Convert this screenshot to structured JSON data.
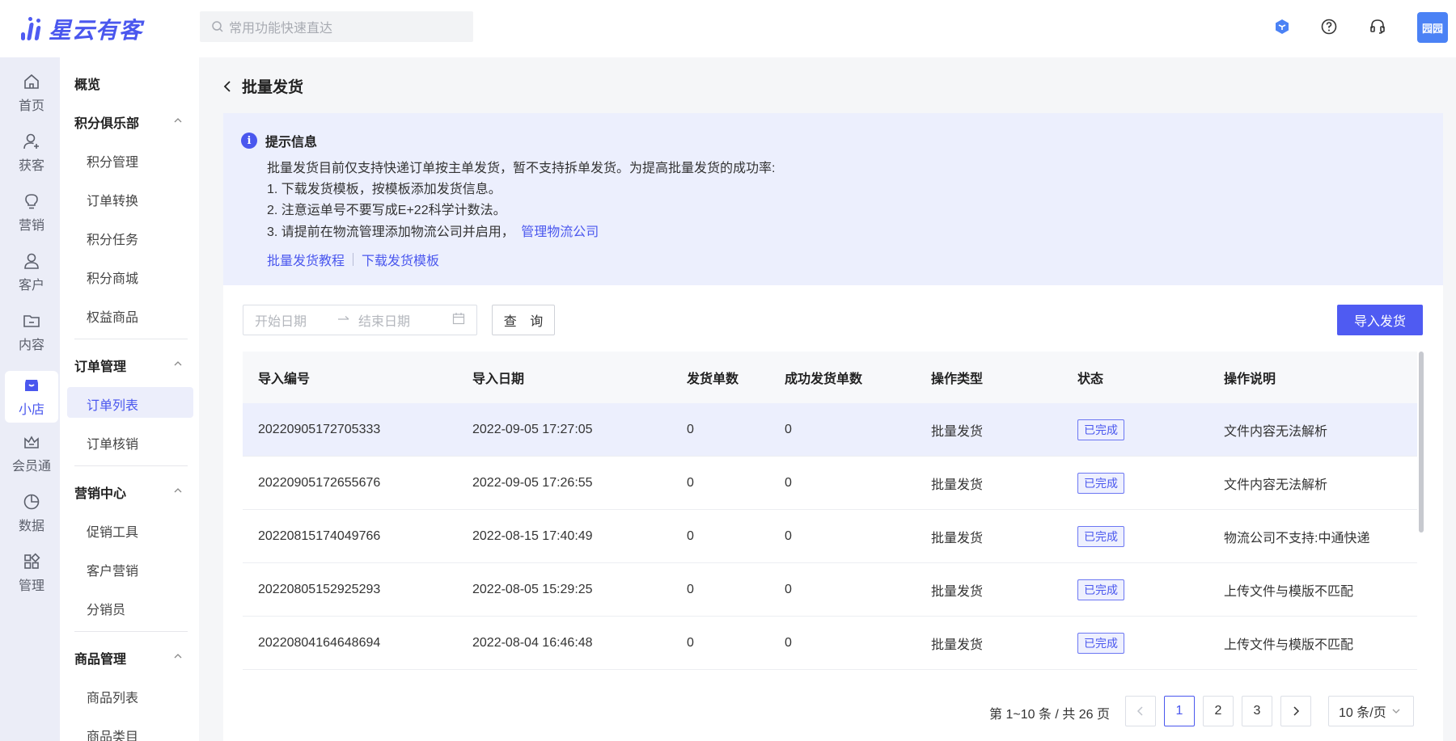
{
  "brand": {
    "name": "星云有客",
    "accent": "#4a57ee"
  },
  "search": {
    "placeholder": "常用功能快速直达"
  },
  "header": {
    "avatar_text": "园园"
  },
  "rail": [
    {
      "label": "首页",
      "icon": "home-icon"
    },
    {
      "label": "获客",
      "icon": "user-add-icon"
    },
    {
      "label": "营销",
      "icon": "bulb-icon"
    },
    {
      "label": "客户",
      "icon": "user-icon"
    },
    {
      "label": "内容",
      "icon": "folder-icon"
    },
    {
      "label": "小店",
      "icon": "shop-icon",
      "active": true
    },
    {
      "label": "会员通",
      "icon": "crown-icon"
    },
    {
      "label": "数据",
      "icon": "pie-chart-icon"
    },
    {
      "label": "管理",
      "icon": "grid-icon"
    }
  ],
  "menu": {
    "overview": "概览",
    "groups": [
      {
        "title": "积分俱乐部",
        "items": [
          "积分管理",
          "订单转换",
          "积分任务",
          "积分商城",
          "权益商品"
        ]
      },
      {
        "title": "订单管理",
        "items": [
          "订单列表",
          "订单核销"
        ],
        "active_item": "订单列表"
      },
      {
        "title": "营销中心",
        "items": [
          "促销工具",
          "客户营销",
          "分销员"
        ]
      },
      {
        "title": "商品管理",
        "items": [
          "商品列表",
          "商品类目"
        ]
      }
    ]
  },
  "page": {
    "title": "批量发货"
  },
  "notice": {
    "title": "提示信息",
    "lines": [
      "批量发货目前仅支持快递订单按主单发货，暂不支持拆单发货。为提高批量发货的成功率:",
      "1. 下载发货模板，按模板添加发货信息。",
      "2. 注意运单号不要写成E+22科学计数法。",
      "3. 请提前在物流管理添加物流公司并启用，"
    ],
    "manage_link": "管理物流公司",
    "tutorial_link": "批量发货教程",
    "template_link": "下载发货模板"
  },
  "filters": {
    "start_placeholder": "开始日期",
    "end_placeholder": "结束日期",
    "query_label": "查 询",
    "import_label": "导入发货"
  },
  "table": {
    "headers": [
      "导入编号",
      "导入日期",
      "发货单数",
      "成功发货单数",
      "操作类型",
      "状态",
      "操作说明"
    ],
    "rows": [
      [
        "20220905172705333",
        "2022-09-05 17:27:05",
        "0",
        "0",
        "批量发货",
        "已完成",
        "文件内容无法解析"
      ],
      [
        "20220905172655676",
        "2022-09-05 17:26:55",
        "0",
        "0",
        "批量发货",
        "已完成",
        "文件内容无法解析"
      ],
      [
        "20220815174049766",
        "2022-08-15 17:40:49",
        "0",
        "0",
        "批量发货",
        "已完成",
        "物流公司不支持:中通快递"
      ],
      [
        "20220805152925293",
        "2022-08-05 15:29:25",
        "0",
        "0",
        "批量发货",
        "已完成",
        "上传文件与模版不匹配"
      ],
      [
        "20220804164648694",
        "2022-08-04 16:46:48",
        "0",
        "0",
        "批量发货",
        "已完成",
        "上传文件与模版不匹配"
      ]
    ]
  },
  "pagination": {
    "info": "第 1~10 条 / 共 26 页",
    "pages": [
      "1",
      "2",
      "3"
    ],
    "current": "1",
    "page_size": "10 条/页"
  }
}
